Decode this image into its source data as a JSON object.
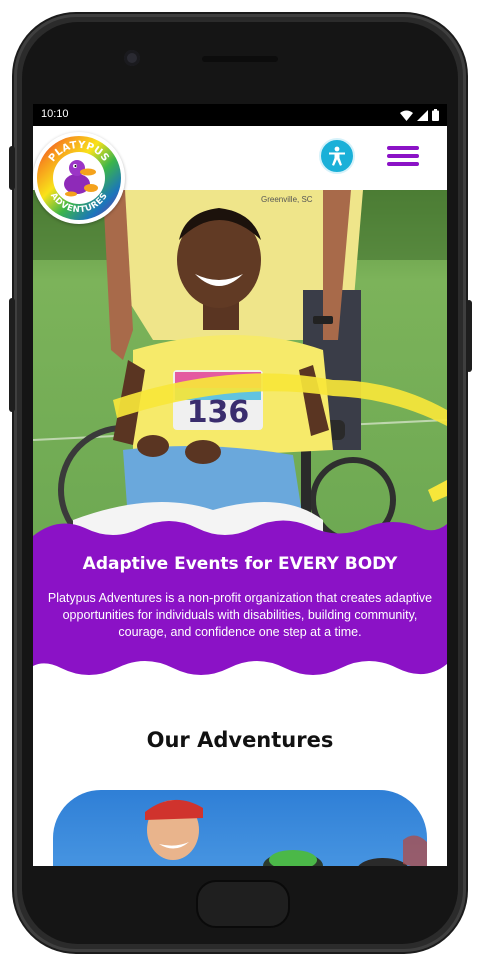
{
  "status_bar": {
    "time": "10:10"
  },
  "header": {
    "logo_text_top": "PLATYPUS",
    "logo_text_bottom": "ADVENTURES"
  },
  "hero": {
    "bib_number": "136",
    "shirt_text": "Greenville, SC"
  },
  "intro": {
    "headline": "Adaptive Events for EVERY BODY",
    "description": "Platypus Adventures is a non-profit organization that creates adaptive opportunities for individuals with disabilities, building community, courage, and confidence one step at a time."
  },
  "adventures": {
    "title": "Our Adventures"
  },
  "colors": {
    "brand_purple": "#8b12c6",
    "accessibility_blue": "#1ab0d8"
  },
  "icons": [
    "wifi-icon",
    "signal-icon",
    "battery-icon",
    "accessibility-icon",
    "hamburger-menu-icon"
  ]
}
